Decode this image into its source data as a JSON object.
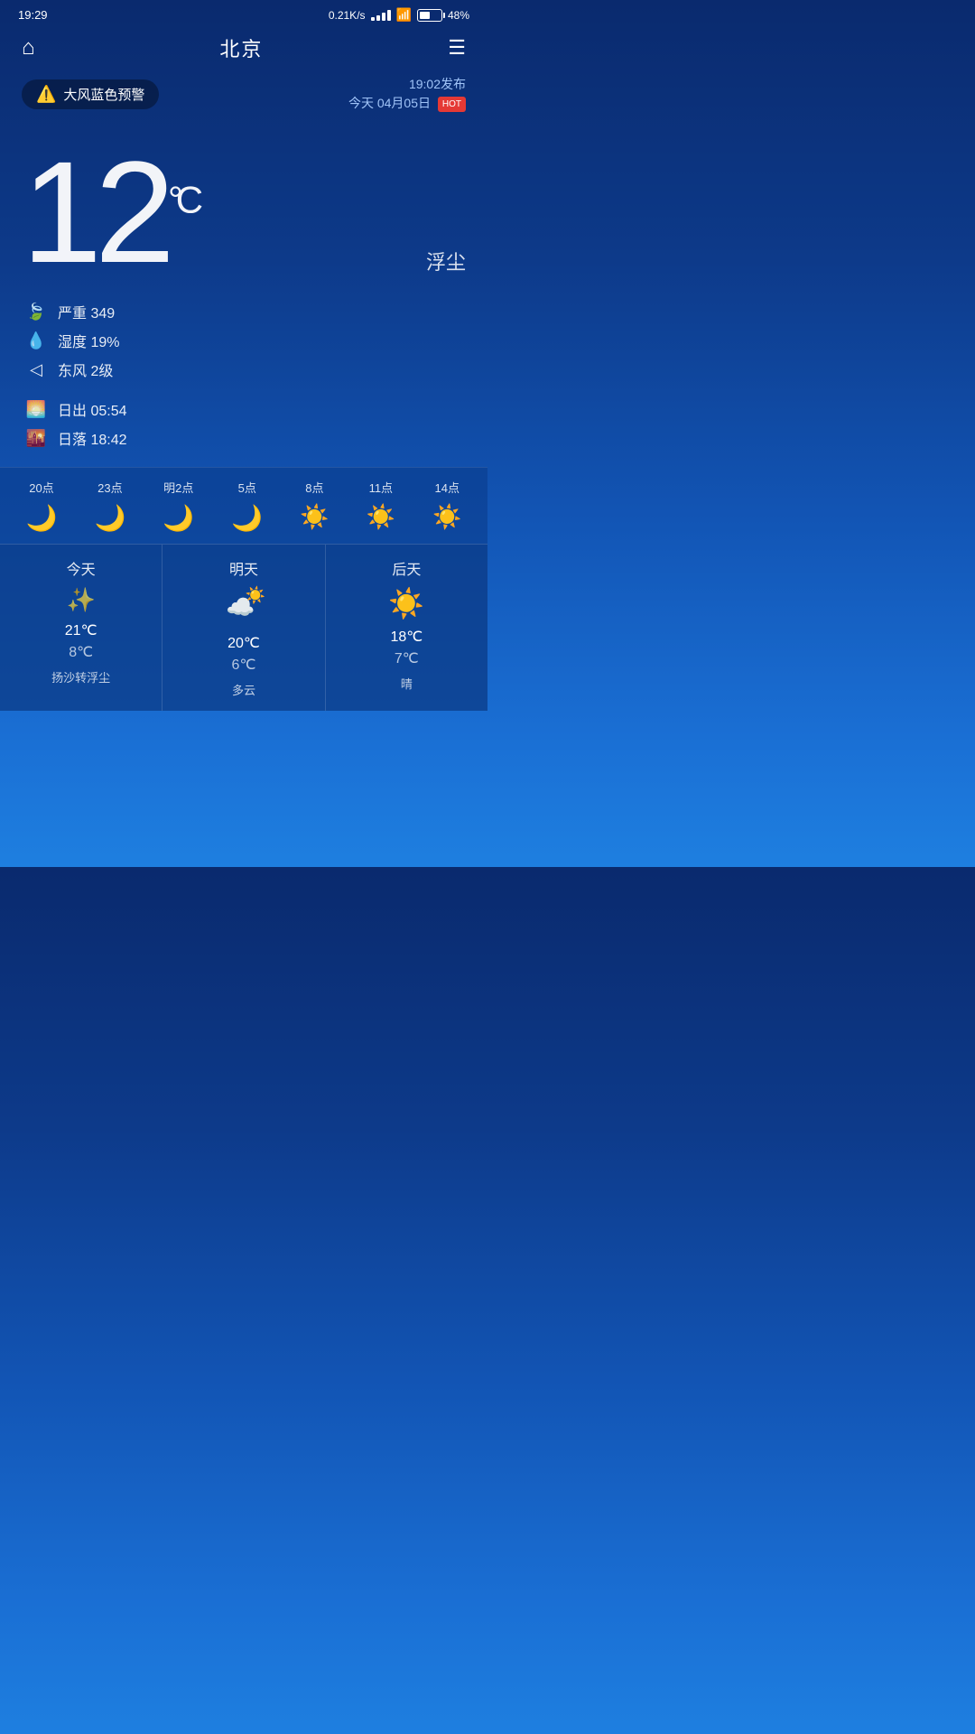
{
  "statusBar": {
    "time": "19:29",
    "speed": "0.21K/s",
    "battery": "48%"
  },
  "header": {
    "city": "北京",
    "homeIcon": "⌂",
    "menuIcon": "☰"
  },
  "alert": {
    "label": "大风蓝色预警",
    "publishTime": "19:02发布",
    "date": "今天 04月05日",
    "hotBadge": "HOT"
  },
  "current": {
    "temperature": "12",
    "unit": "°C",
    "condition": "浮尘"
  },
  "details": {
    "aqi": "严重 349",
    "humidity": "湿度 19%",
    "wind": "东风 2级",
    "sunrise": "日出  05:54",
    "sunset": "日落  18:42"
  },
  "hourly": [
    {
      "time": "20点",
      "icon": "moon"
    },
    {
      "time": "23点",
      "icon": "moon"
    },
    {
      "time": "明2点",
      "icon": "moon"
    },
    {
      "time": "5点",
      "icon": "moon"
    },
    {
      "time": "8点",
      "icon": "sun"
    },
    {
      "time": "11点",
      "icon": "sun"
    },
    {
      "time": "14点",
      "icon": "sun"
    }
  ],
  "daily": [
    {
      "day": "今天",
      "icon": "stars",
      "high": "21℃",
      "low": "8℃",
      "desc": "扬沙转浮尘"
    },
    {
      "day": "明天",
      "icon": "cloud-sun",
      "high": "20℃",
      "low": "6℃",
      "desc": "多云"
    },
    {
      "day": "后天",
      "icon": "sun",
      "high": "18℃",
      "low": "7℃",
      "desc": "晴"
    }
  ]
}
